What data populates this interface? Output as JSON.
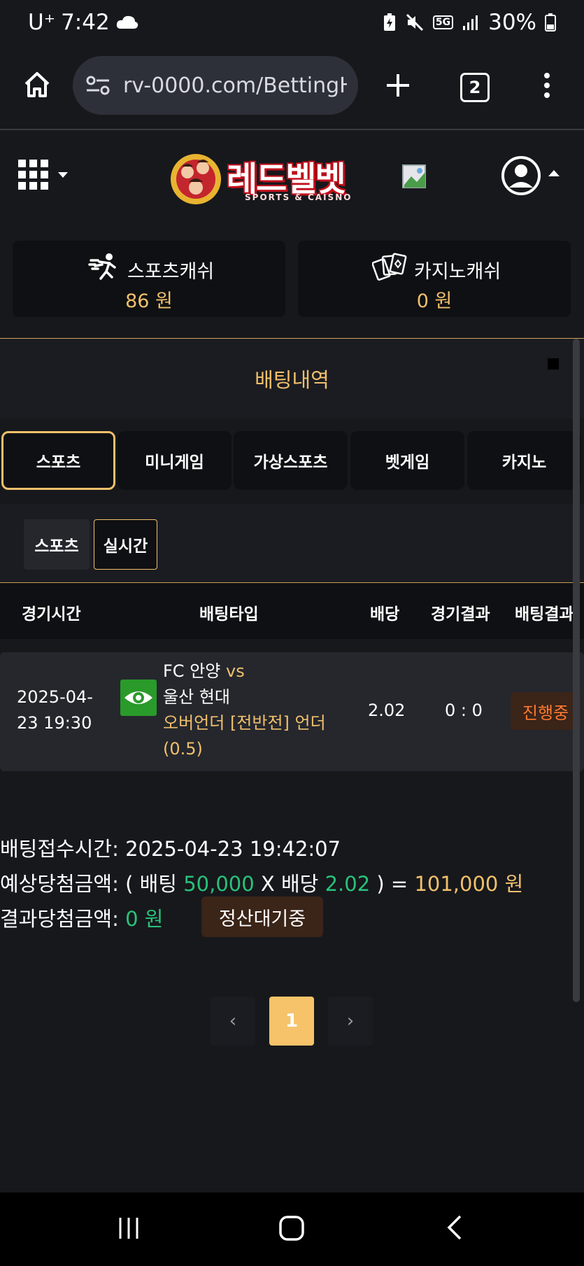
{
  "status_bar": {
    "carrier": "U⁺",
    "time": "7:42",
    "network": "5G",
    "battery": "30%"
  },
  "browser": {
    "url": "rv-0000.com/BettingH",
    "tab_count": "2"
  },
  "site": {
    "logo_text": "레드벨벳",
    "logo_sub": "SPORTS & CAISNO"
  },
  "wallets": [
    {
      "label": "스포츠캐쉬",
      "amount": "86 원",
      "icon": "running-person-icon"
    },
    {
      "label": "카지노캐쉬",
      "amount": "0 원",
      "icon": "playing-cards-icon"
    }
  ],
  "section_title": "배팅내역",
  "tabs": [
    "스포츠",
    "미니게임",
    "가상스포츠",
    "벳게임",
    "카지노"
  ],
  "subtabs": [
    "스포츠",
    "실시간"
  ],
  "table": {
    "headers": [
      "경기시간",
      "배팅타입",
      "배당",
      "경기결과",
      "배팅결과"
    ],
    "rows": [
      {
        "time_line1": "2025-04-",
        "time_line2": "23 19:30",
        "home": "FC 안양",
        "vs": "vs",
        "away": "울산 현대",
        "bet_type": "오버언더 [전반전] 언더",
        "bet_line": "(0.5)",
        "odds": "2.02",
        "score": "0 : 0",
        "result": "진행중"
      }
    ]
  },
  "summary": {
    "received_label": "배팅접수시간:",
    "received_value": "2025-04-23 19:42:07",
    "expected_label": "예상당첨금액:",
    "expected_open": "( 배팅",
    "bet_amount": "50,000",
    "x_label": "X 배당",
    "odds": "2.02",
    "close": ") =",
    "payout": "101,000 원",
    "result_label": "결과당첨금액:",
    "result_value": "0 원",
    "settle_button": "정산대기중"
  },
  "pagination": {
    "prev": "‹",
    "current": "1",
    "next": "›"
  },
  "colors": {
    "gold": "#f0c06c",
    "green": "#28c27a",
    "orange": "#ff7a2e",
    "bg": "#17181c"
  }
}
